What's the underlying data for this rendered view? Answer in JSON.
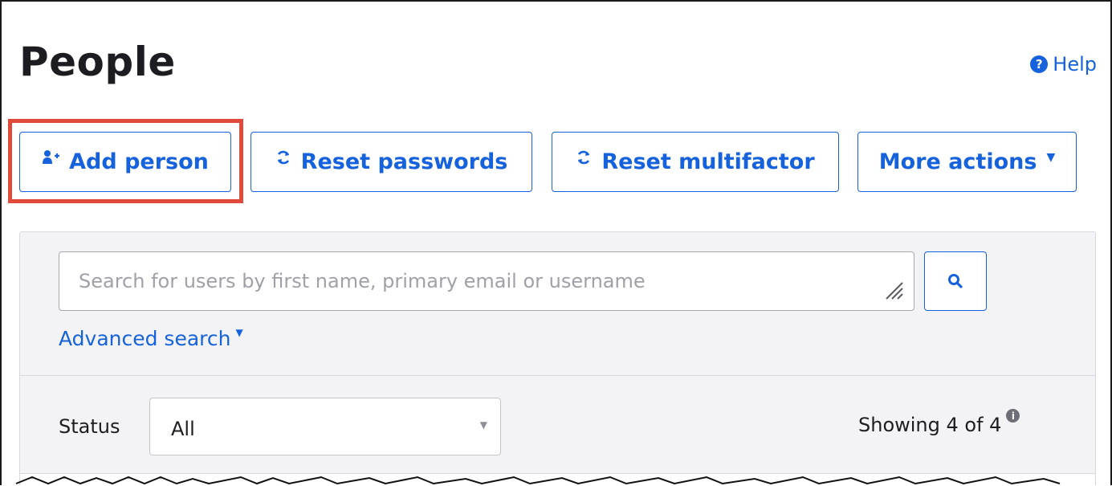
{
  "page": {
    "title": "People"
  },
  "help": {
    "label": "Help",
    "icon": "question-circle-icon",
    "color": "#1662dd"
  },
  "toolbar": {
    "add_person": {
      "label": "Add person",
      "icon": "add-person-icon"
    },
    "reset_passwords": {
      "label": "Reset passwords",
      "icon": "refresh-icon"
    },
    "reset_multifactor": {
      "label": "Reset multifactor",
      "icon": "refresh-icon"
    },
    "more_actions": {
      "label": "More actions",
      "icon": "caret-down-icon"
    }
  },
  "highlight": {
    "target": "add-person-button",
    "color": "#e04a3b"
  },
  "search": {
    "placeholder": "Search for users by first name, primary email or username",
    "value": "",
    "button_icon": "search-icon"
  },
  "advanced_search": {
    "label": "Advanced search"
  },
  "filters": {
    "status_label": "Status",
    "status_value": "All",
    "showing_text": "Showing 4 of 4"
  },
  "colors": {
    "accent": "#1662dd",
    "panel_bg": "#f3f3f5",
    "text": "#1d1d21"
  }
}
